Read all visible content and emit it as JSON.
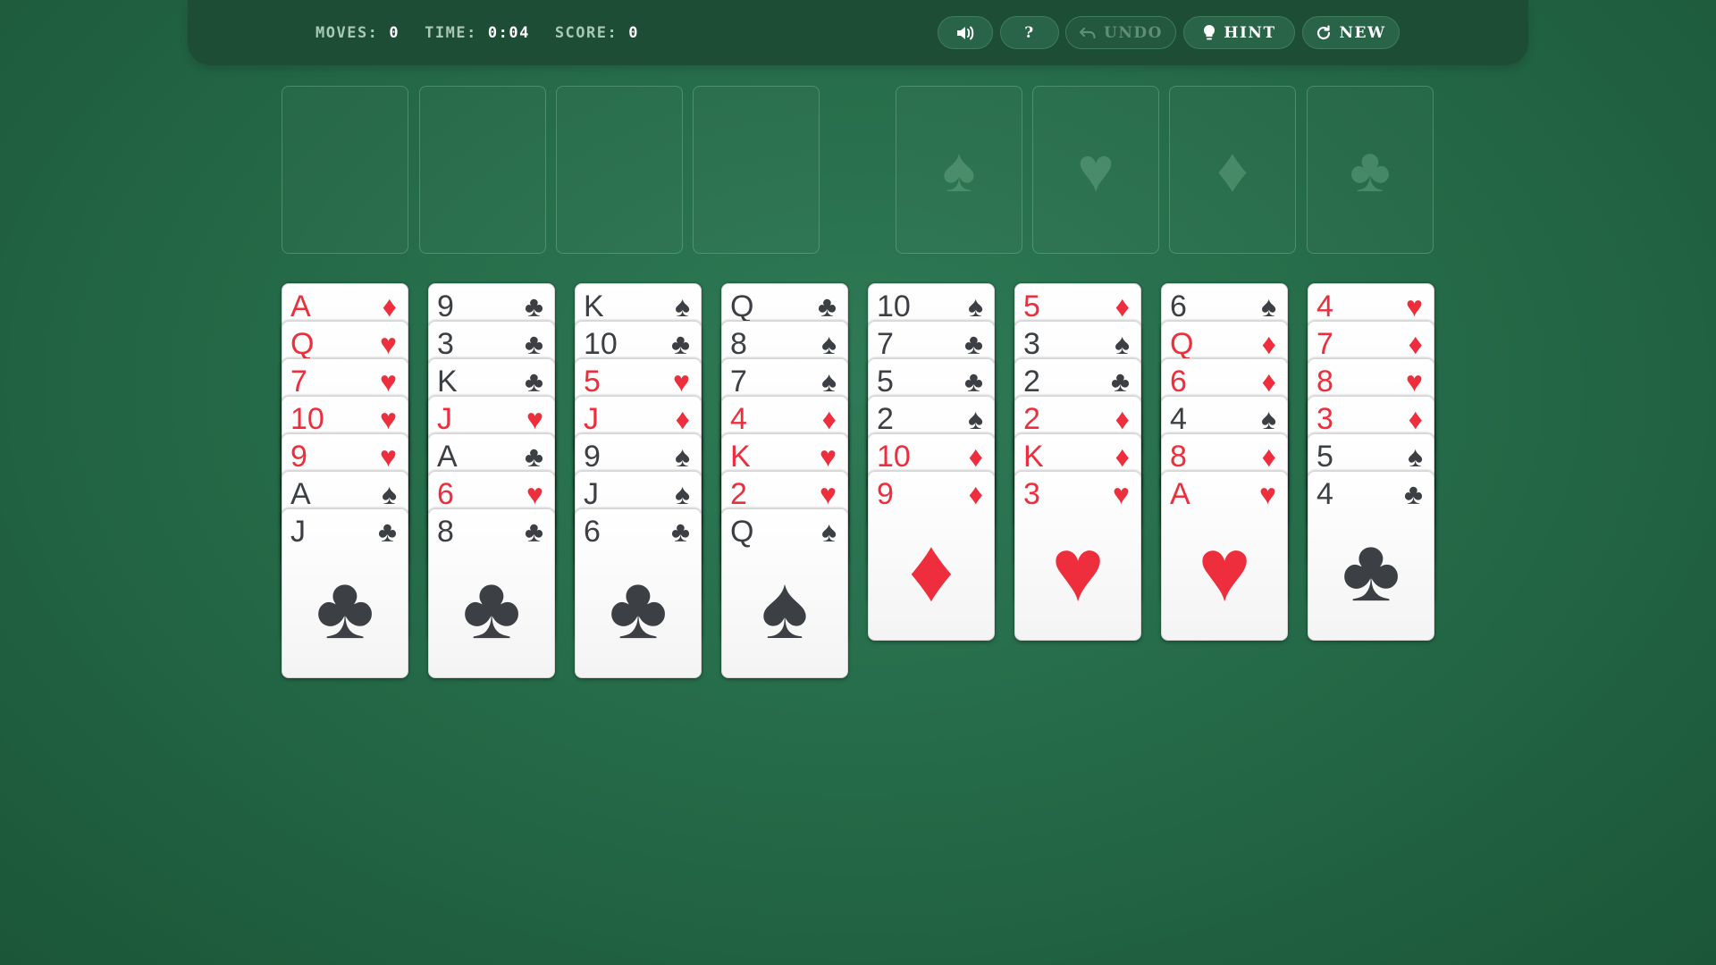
{
  "stats": [
    {
      "label": "MOVES:",
      "value": "0"
    },
    {
      "label": "TIME:",
      "value": "0:04"
    },
    {
      "label": "SCORE:",
      "value": "0"
    }
  ],
  "toolbar": {
    "sound_label": "",
    "help_label": "?",
    "undo_label": "UNDO",
    "hint_label": "HINT",
    "new_label": "NEW",
    "undo_enabled": false
  },
  "free_cells": [
    {},
    {},
    {},
    {}
  ],
  "foundations": [
    {
      "suit": "spades",
      "symbol": "♠"
    },
    {
      "suit": "hearts",
      "symbol": "♥"
    },
    {
      "suit": "diamonds",
      "symbol": "♦"
    },
    {
      "suit": "clubs",
      "symbol": "♣"
    }
  ],
  "colors": {
    "red": "#ee2e3c",
    "black": "#3c3f43",
    "felt": "#256b49"
  },
  "tableau": [
    [
      [
        "A",
        "diamonds"
      ],
      [
        "Q",
        "hearts"
      ],
      [
        "7",
        "hearts"
      ],
      [
        "10",
        "hearts"
      ],
      [
        "9",
        "hearts"
      ],
      [
        "A",
        "spades"
      ],
      [
        "J",
        "clubs"
      ]
    ],
    [
      [
        "9",
        "clubs"
      ],
      [
        "3",
        "clubs"
      ],
      [
        "K",
        "clubs"
      ],
      [
        "J",
        "hearts"
      ],
      [
        "A",
        "clubs"
      ],
      [
        "6",
        "hearts"
      ],
      [
        "8",
        "clubs"
      ]
    ],
    [
      [
        "K",
        "spades"
      ],
      [
        "10",
        "clubs"
      ],
      [
        "5",
        "hearts"
      ],
      [
        "J",
        "diamonds"
      ],
      [
        "9",
        "spades"
      ],
      [
        "J",
        "spades"
      ],
      [
        "6",
        "clubs"
      ]
    ],
    [
      [
        "Q",
        "clubs"
      ],
      [
        "8",
        "spades"
      ],
      [
        "7",
        "spades"
      ],
      [
        "4",
        "diamonds"
      ],
      [
        "K",
        "hearts"
      ],
      [
        "2",
        "hearts"
      ],
      [
        "Q",
        "spades"
      ]
    ],
    [
      [
        "10",
        "spades"
      ],
      [
        "7",
        "clubs"
      ],
      [
        "5",
        "clubs"
      ],
      [
        "2",
        "spades"
      ],
      [
        "10",
        "diamonds"
      ],
      [
        "9",
        "diamonds"
      ]
    ],
    [
      [
        "5",
        "diamonds"
      ],
      [
        "3",
        "spades"
      ],
      [
        "2",
        "clubs"
      ],
      [
        "2",
        "diamonds"
      ],
      [
        "K",
        "diamonds"
      ],
      [
        "3",
        "hearts"
      ]
    ],
    [
      [
        "6",
        "spades"
      ],
      [
        "Q",
        "diamonds"
      ],
      [
        "6",
        "diamonds"
      ],
      [
        "4",
        "spades"
      ],
      [
        "8",
        "diamonds"
      ],
      [
        "A",
        "hearts"
      ]
    ],
    [
      [
        "4",
        "hearts"
      ],
      [
        "7",
        "diamonds"
      ],
      [
        "8",
        "hearts"
      ],
      [
        "3",
        "diamonds"
      ],
      [
        "5",
        "spades"
      ],
      [
        "4",
        "clubs"
      ]
    ]
  ]
}
